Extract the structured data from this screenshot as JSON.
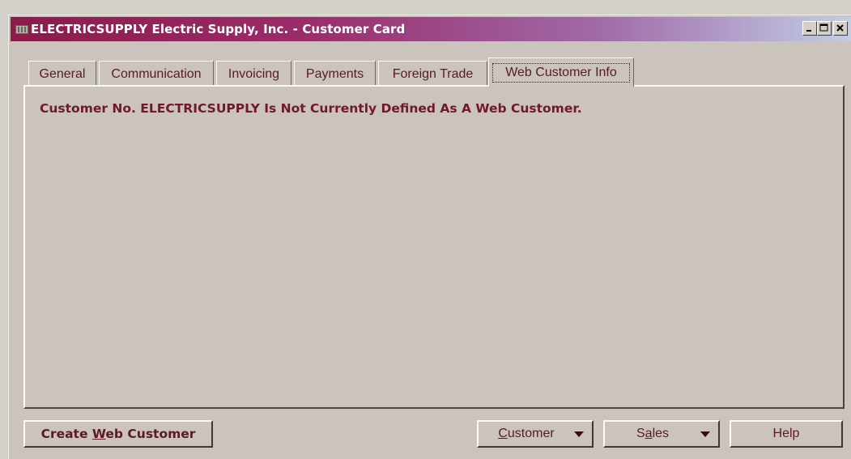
{
  "window": {
    "title": "ELECTRICSUPPLY Electric Supply, Inc. - Customer Card",
    "minimize_icon": "minimize-icon",
    "maximize_icon": "maximize-icon",
    "close_icon": "close-icon"
  },
  "tabs": [
    {
      "label": "General"
    },
    {
      "label": "Communication"
    },
    {
      "label": "Invoicing"
    },
    {
      "label": "Payments"
    },
    {
      "label": "Foreign Trade"
    },
    {
      "label": "Web Customer Info",
      "active": true
    }
  ],
  "panel": {
    "message": "Customer No. ELECTRICSUPPLY Is Not Currently Defined As A Web Customer."
  },
  "buttons": {
    "create_pre": "Create ",
    "create_ul": "W",
    "create_post": "eb Customer",
    "customer_ul": "C",
    "customer_post": "ustomer",
    "sales_pre": "S",
    "sales_ul": "a",
    "sales_post": "les",
    "help": "Help"
  },
  "colors": {
    "text": "#5a1a24",
    "title_start": "#8a1c4a",
    "title_end": "#c2cde6"
  }
}
